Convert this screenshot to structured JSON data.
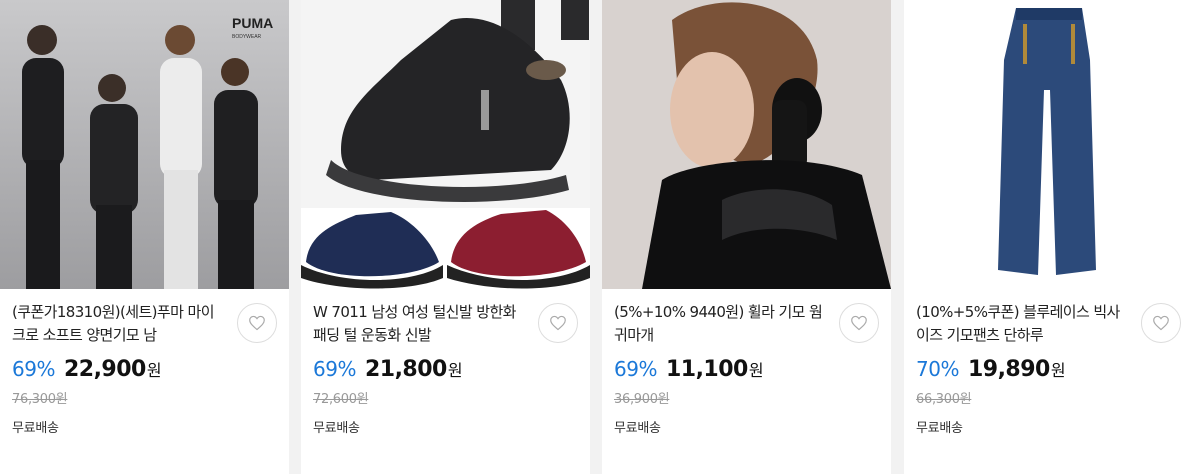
{
  "products": [
    {
      "title": "(쿠폰가18310원)(세트)푸마 마이크로 소프트 양면기모 남",
      "discount": "69%",
      "price": "22,900",
      "currency": "원",
      "original_price": "76,300원",
      "shipping": "무료배송",
      "image_brand_text": "PUMA"
    },
    {
      "title": "W 7011 남성 여성 털신발 방한화 패딩 털 운동화 신발",
      "discount": "69%",
      "price": "21,800",
      "currency": "원",
      "original_price": "72,600원",
      "shipping": "무료배송"
    },
    {
      "title": "(5%+10% 9440원) 휠라 기모 웜 귀마개",
      "discount": "69%",
      "price": "11,100",
      "currency": "원",
      "original_price": "36,900원",
      "shipping": "무료배송"
    },
    {
      "title": "(10%+5%쿠폰) 블루레이스 빅사이즈 기모팬츠 단하루",
      "discount": "70%",
      "price": "19,890",
      "currency": "원",
      "original_price": "66,300원",
      "shipping": "무료배송"
    }
  ],
  "colors": {
    "discount": "#1b78d8",
    "background": "#f2f2f2",
    "card": "#ffffff"
  },
  "icons": {
    "wishlist": "heart-icon"
  }
}
